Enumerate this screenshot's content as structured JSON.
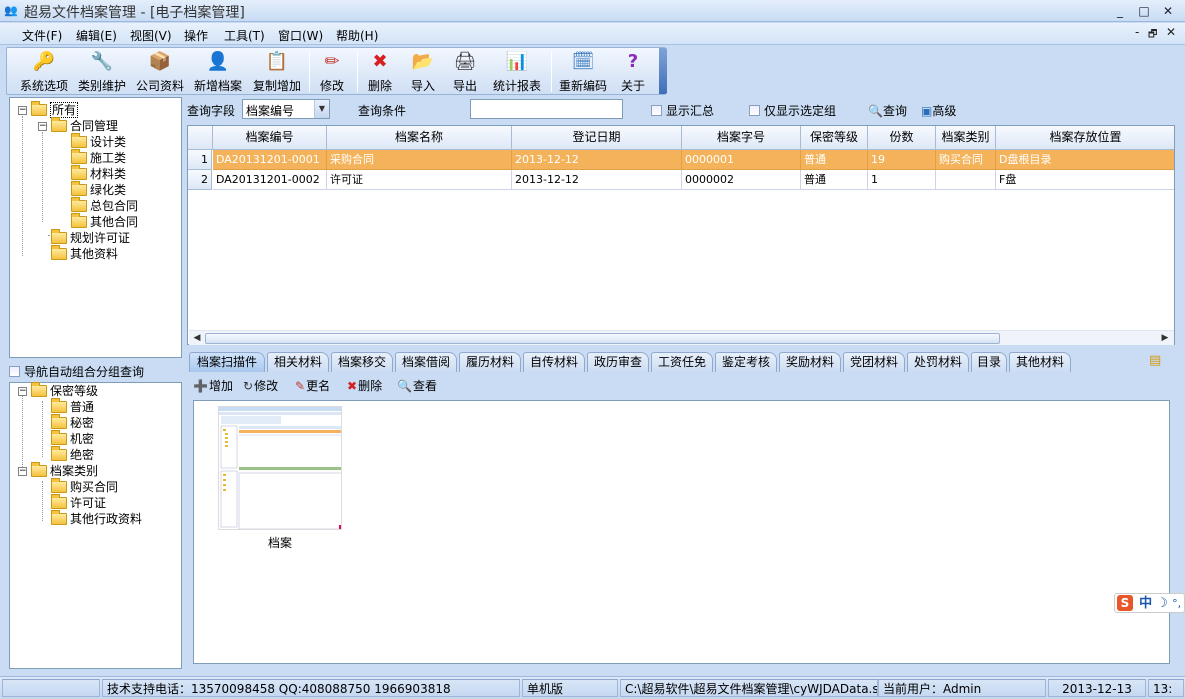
{
  "window": {
    "title": "超易文件档案管理 - [电子档案管理]",
    "min": "_",
    "max": "□",
    "close": "✕",
    "mdi_min": "-",
    "mdi_restore": "🗗",
    "mdi_close": "✕"
  },
  "menu": [
    "文件(F)",
    "编辑(E)",
    "视图(V)",
    "操作",
    "工具(T)",
    "窗口(W)",
    "帮助(H)"
  ],
  "toolbar": [
    {
      "label": "系统选项",
      "icon": "🔑"
    },
    {
      "label": "类别维护",
      "icon": "🔧"
    },
    {
      "label": "公司资料",
      "icon": "📦"
    },
    {
      "label": "新增档案",
      "icon": "👤"
    },
    {
      "label": "复制增加",
      "icon": "📋"
    },
    {
      "label": "修改",
      "icon": "✏"
    },
    {
      "label": "删除",
      "icon": "✖"
    },
    {
      "label": "导入",
      "icon": "📂"
    },
    {
      "label": "导出",
      "icon": "🖨"
    },
    {
      "label": "统计报表",
      "icon": "📊"
    },
    {
      "label": "重新编码",
      "icon": "🗓"
    },
    {
      "label": "关于",
      "icon": "?"
    }
  ],
  "tree1": {
    "root": "所有",
    "contract": "合同管理",
    "contract_children": [
      "设计类",
      "施工类",
      "材料类",
      "绿化类",
      "总包合同",
      "其他合同"
    ],
    "others": [
      "规划许可证",
      "其他资料"
    ]
  },
  "nav_check_label": "导航自动组合分组查询",
  "tree2": {
    "security": "保密等级",
    "security_children": [
      "普通",
      "秘密",
      "机密",
      "绝密"
    ],
    "category": "档案类别",
    "category_children": [
      "购买合同",
      "许可证",
      "其他行政资料"
    ]
  },
  "query": {
    "field_label": "查询字段",
    "field_value": "档案编号",
    "cond_label": "查询条件",
    "cond_value": "",
    "show_summary": "显示汇总",
    "only_selected": "仅显示选定组",
    "search_btn": "查询",
    "advanced_btn": "高级"
  },
  "grid": {
    "columns": [
      "档案编号",
      "档案名称",
      "登记日期",
      "档案字号",
      "保密等级",
      "份数",
      "档案类别",
      "档案存放位置"
    ],
    "rows": [
      {
        "n": "1",
        "cells": [
          "DA20131201-0001",
          "采购合同",
          "2013-12-12",
          "0000001",
          "普通",
          "19",
          "购买合同",
          "D盘根目录"
        ]
      },
      {
        "n": "2",
        "cells": [
          "DA20131201-0002",
          "许可证",
          "2013-12-12",
          "0000002",
          "普通",
          "1",
          "",
          "F盘"
        ]
      }
    ]
  },
  "tabs": [
    "档案扫描件",
    "相关材料",
    "档案移交",
    "档案借阅",
    "履历材料",
    "自传材料",
    "政历审查",
    "工资任免",
    "鉴定考核",
    "奖励材料",
    "党团材料",
    "处罚材料",
    "目录",
    "其他材料"
  ],
  "subtoolbar": [
    {
      "label": "增加",
      "icon": "➕"
    },
    {
      "label": "修改",
      "icon": "↻"
    },
    {
      "label": "更名",
      "icon": "✎"
    },
    {
      "label": "删除",
      "icon": "✖"
    },
    {
      "label": "查看",
      "icon": "🔍"
    }
  ],
  "thumbnail": {
    "caption": "档案"
  },
  "status": {
    "support": "技术支持电话：13570098458 QQ:408088750 1966903818",
    "edition": "单机版",
    "path": "C:\\超易软件\\超易文件档案管理\\cyWJDAData.sys",
    "user": "当前用户：Admin",
    "date": "2013-12-13",
    "time": "13:"
  },
  "ime": {
    "logo": "S",
    "mode": "中",
    "moon": "☽",
    "punct": "°,"
  },
  "colors": {
    "selected_row": "#f4b35a",
    "chrome": "#c9dcf3",
    "border": "#7f9db9"
  }
}
